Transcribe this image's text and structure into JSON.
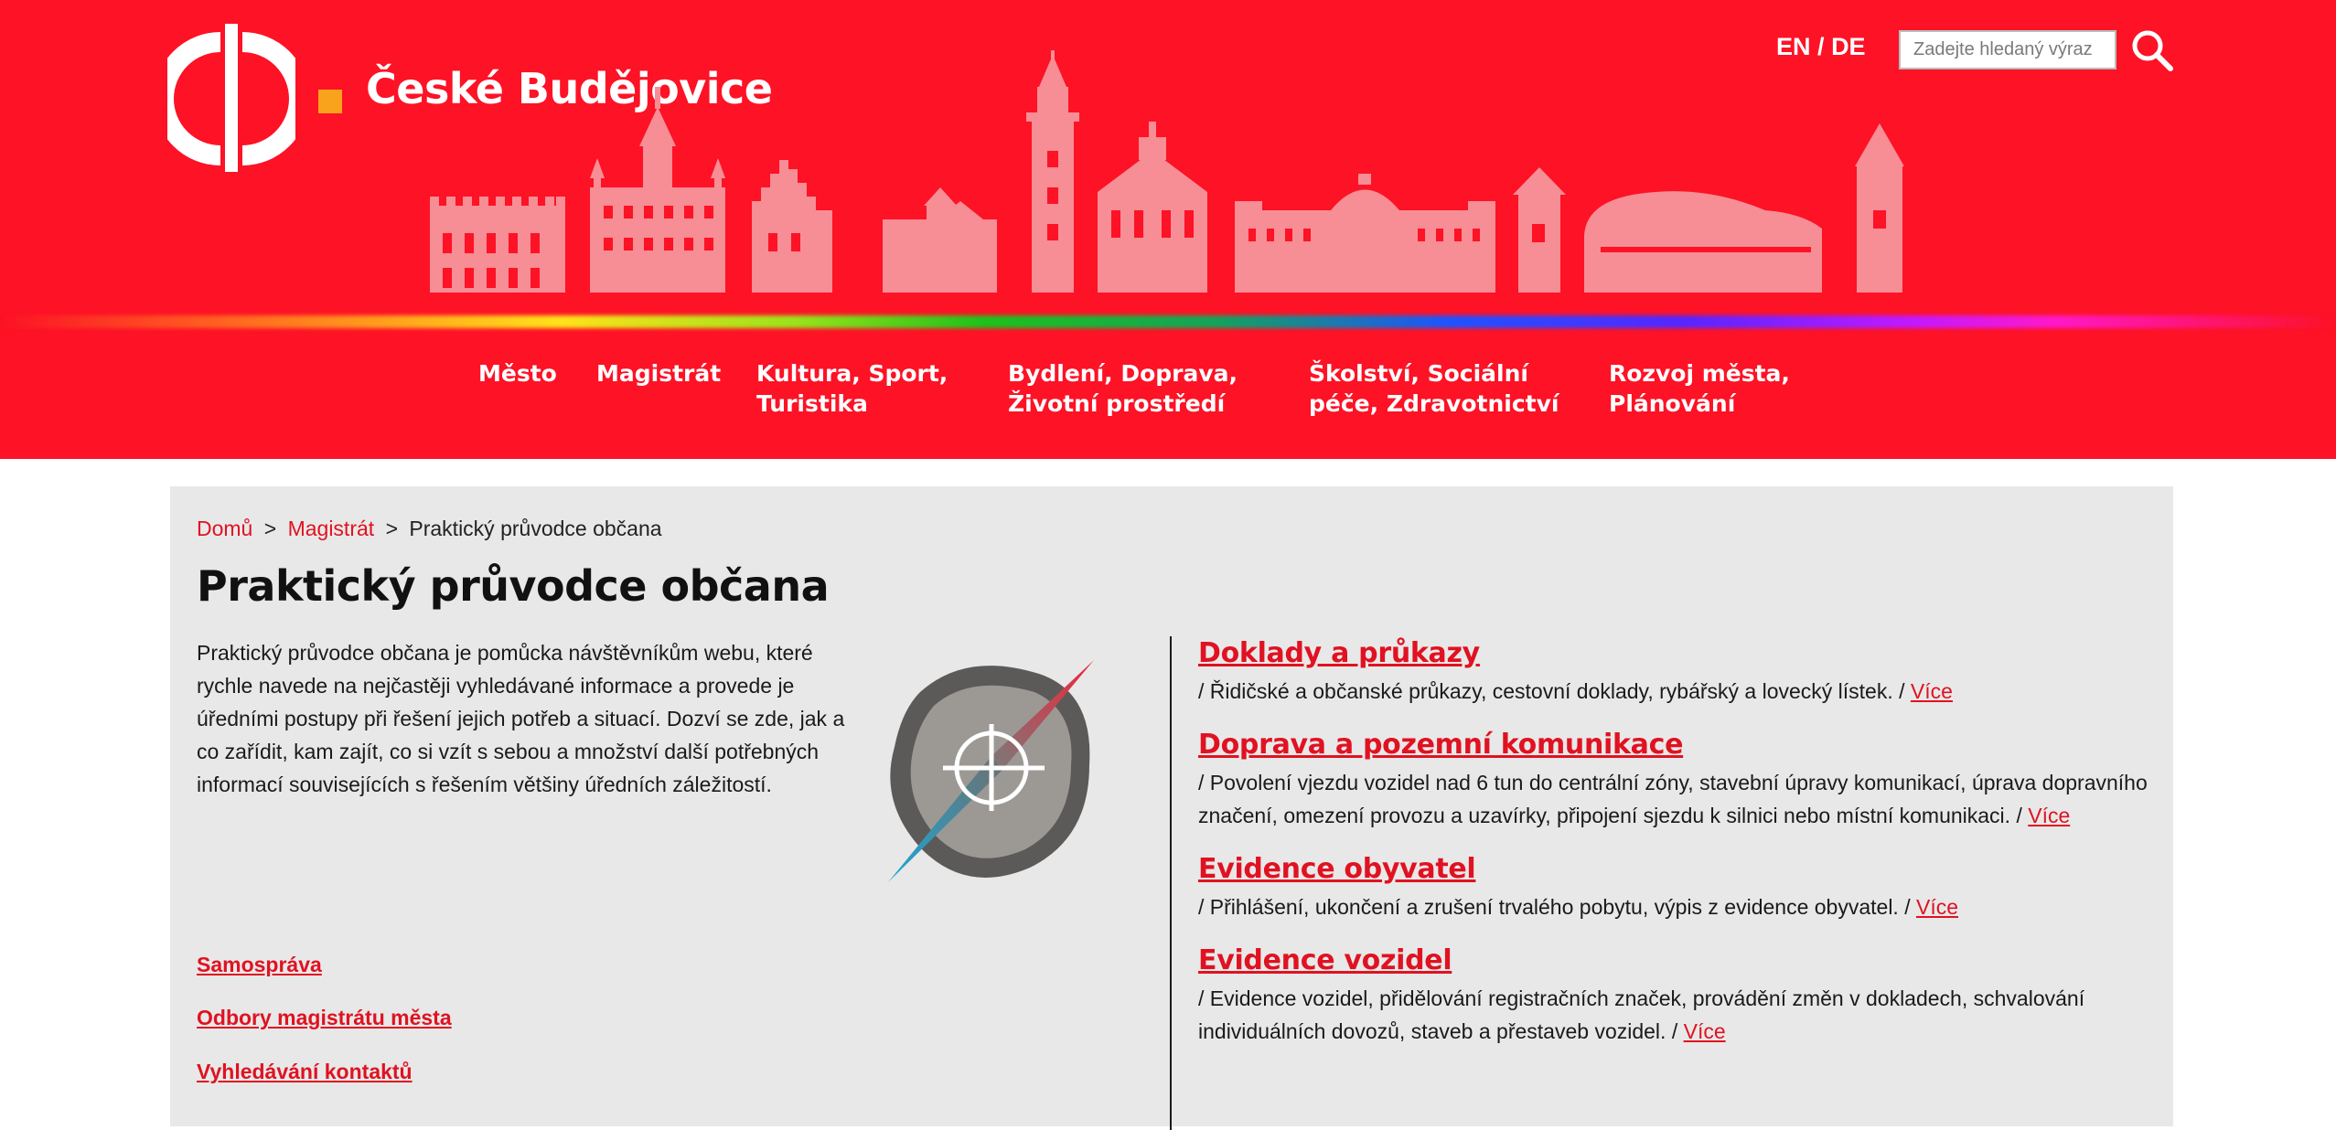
{
  "header": {
    "city_name": "České Budějovice",
    "lang_en": "EN",
    "lang_sep": "/",
    "lang_de": "DE",
    "search_placeholder": "Zadejte hledaný výraz",
    "search_icon": "search-icon",
    "logo_icon": "city-logo",
    "brand_color": "#fd1226",
    "accent_color": "#f9a21b"
  },
  "nav": {
    "items": [
      {
        "line1": "Město",
        "line2": ""
      },
      {
        "line1": "Magistrát",
        "line2": ""
      },
      {
        "line1": "Kultura, Sport,",
        "line2": "Turistika"
      },
      {
        "line1": "Bydlení, Doprava,",
        "line2": "Životní prostředí"
      },
      {
        "line1": "Školství, Sociální",
        "line2": "péče, Zdravotnictví"
      },
      {
        "line1": "Rozvoj města,",
        "line2": "Plánování"
      }
    ]
  },
  "breadcrumb": {
    "home": "Domů",
    "sep": ">",
    "parent": "Magistrát",
    "current": "Praktický průvodce občana"
  },
  "page": {
    "title": "Praktický průvodce občana",
    "intro": "Praktický průvodce občana je pomůcka návštěvníkům webu, které rychle navede na nejčastěji vyhledávané informace a provede je úředními postupy při řešení jejich potřeb a situací. Dozví se zde, jak a co zařídit, kam zajít, co si vzít s sebou a množství další potřebných informací souvisejících s řešením většiny úředních záležitostí.",
    "compass_icon": "compass-icon"
  },
  "sidebar": {
    "links": [
      "Samospráva",
      "Odbory magistrátu města",
      "Vyhledávání kontaktů"
    ]
  },
  "topics": [
    {
      "title": "Doklady a průkazy",
      "desc": "/ Řidičské a občanské průkazy, cestovní doklady, rybářský a lovecký lístek. /",
      "more": "Více"
    },
    {
      "title": "Doprava a pozemní komunikace",
      "desc": "/ Povolení vjezdu vozidel nad 6 tun do centrální zóny, stavební úpravy komunikací, úprava dopravního značení, omezení provozu a uzavírky, připojení sjezdu k silnici nebo místní komunikaci. /",
      "more": "Více"
    },
    {
      "title": "Evidence obyvatel",
      "desc": "/ Přihlášení, ukončení a zrušení trvalého pobytu, výpis z evidence obyvatel. /",
      "more": "Více"
    },
    {
      "title": "Evidence vozidel",
      "desc": "/ Evidence vozidel, přidělování registračních značek, provádění změn v dokladech, schvalování individuálních dovozů, staveb a přestaveb vozidel. /",
      "more": "Více"
    }
  ]
}
